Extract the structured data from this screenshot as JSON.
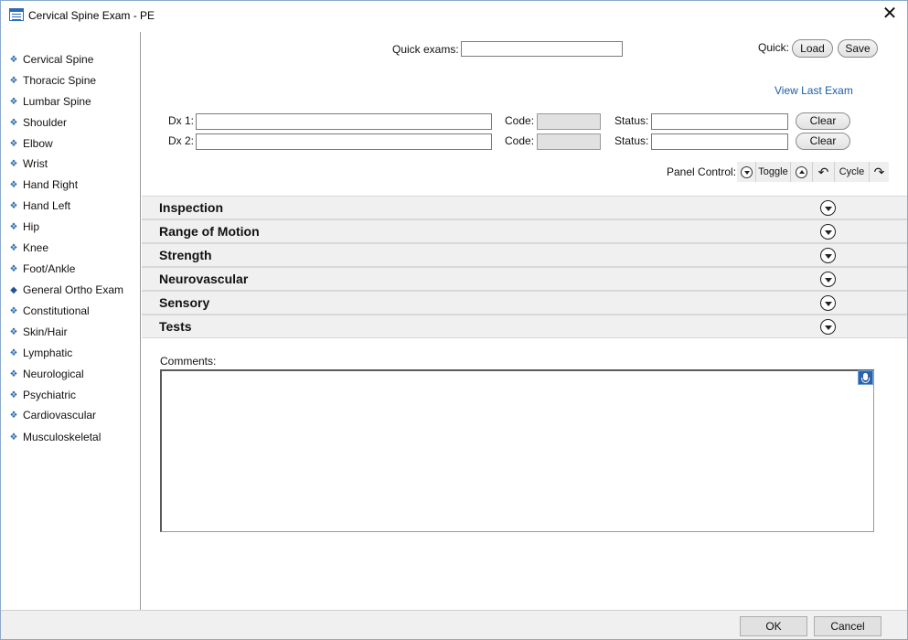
{
  "window": {
    "title": "Cervical Spine Exam - PE",
    "close_glyph": "✕"
  },
  "sidebar": {
    "items": [
      {
        "label": "Cervical Spine",
        "bullet": "❖"
      },
      {
        "label": "Thoracic Spine",
        "bullet": "❖"
      },
      {
        "label": "Lumbar Spine",
        "bullet": "❖"
      },
      {
        "label": "Shoulder",
        "bullet": "❖"
      },
      {
        "label": "Elbow",
        "bullet": "❖"
      },
      {
        "label": "Wrist",
        "bullet": "❖"
      },
      {
        "label": "Hand Right",
        "bullet": "❖"
      },
      {
        "label": "Hand Left",
        "bullet": "❖"
      },
      {
        "label": "Hip",
        "bullet": "❖"
      },
      {
        "label": "Knee",
        "bullet": "❖"
      },
      {
        "label": "Foot/Ankle",
        "bullet": "❖"
      },
      {
        "label": "General Ortho Exam",
        "bullet": "◆"
      },
      {
        "label": "Constitutional",
        "bullet": "❖"
      },
      {
        "label": "Skin/Hair",
        "bullet": "❖"
      },
      {
        "label": "Lymphatic",
        "bullet": "❖"
      },
      {
        "label": "Neurological",
        "bullet": "❖"
      },
      {
        "label": "Psychiatric",
        "bullet": "❖"
      },
      {
        "label": "Cardiovascular",
        "bullet": "❖"
      },
      {
        "label": "Musculoskeletal",
        "bullet": "❖"
      }
    ]
  },
  "quick": {
    "exams_label": "Quick exams:",
    "exams_value": "",
    "label": "Quick:",
    "load": "Load",
    "save": "Save"
  },
  "view_last_exam": "View Last Exam",
  "dx": [
    {
      "label": "Dx 1:",
      "value": "",
      "code_label": "Code:",
      "code_value": "",
      "status_label": "Status:",
      "status_value": "",
      "clear": "Clear"
    },
    {
      "label": "Dx 2:",
      "value": "",
      "code_label": "Code:",
      "code_value": "",
      "status_label": "Status:",
      "status_value": "",
      "clear": "Clear"
    }
  ],
  "panel_control": {
    "label": "Panel Control:",
    "toggle": "Toggle",
    "cycle": "Cycle",
    "undo_glyph": "↶",
    "redo_glyph": "↷"
  },
  "panels": [
    {
      "title": "Inspection"
    },
    {
      "title": "Range of Motion"
    },
    {
      "title": "Strength"
    },
    {
      "title": "Neurovascular"
    },
    {
      "title": "Sensory"
    },
    {
      "title": "Tests"
    }
  ],
  "comments": {
    "label": "Comments:",
    "value": ""
  },
  "footer": {
    "ok": "OK",
    "cancel": "Cancel"
  },
  "colors": {
    "accent": "#2f6fb0",
    "link": "#1a5ea8",
    "panel_bg": "#f0f0f0"
  }
}
